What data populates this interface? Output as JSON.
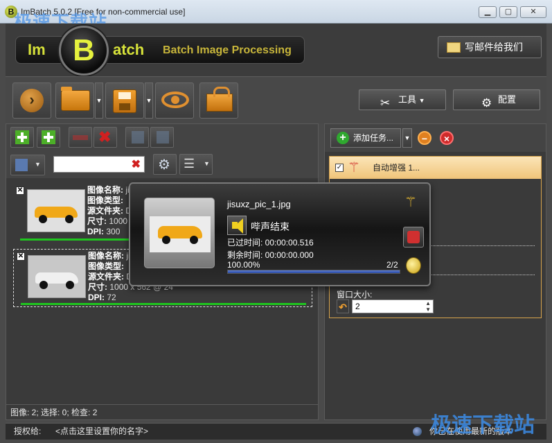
{
  "window": {
    "title": "ImBatch 5.0.2 [Free for non-commercial use]",
    "minimize_icon": "minimize-icon",
    "maximize_icon": "maximize-icon",
    "close_icon": "close-icon"
  },
  "watermark_top": "极速下载站",
  "header": {
    "logo_im": "Im",
    "logo_b": "B",
    "logo_atch": "atch",
    "tagline": "Batch Image Processing",
    "mail_button": "写邮件给我们"
  },
  "toolbar": {
    "tools_label": "工具",
    "settings_label": "配置"
  },
  "left_panel": {
    "search_value": "",
    "images": [
      {
        "checked": "✕",
        "name_label": "图像名称:",
        "name_value": "jis",
        "type_label": "图像类型:",
        "folder_label": "源文件夹:",
        "folder_value": "D:",
        "size_label": "尺寸:",
        "size_value": "1000 x",
        "dpi_label": "DPI:",
        "dpi_value": "300"
      },
      {
        "checked": "✕",
        "name_label": "图像名称:",
        "name_value": "jis",
        "type_label": "图像类型:",
        "folder_label": "源文件夹:",
        "folder_value": "D:",
        "size_label": "尺寸:",
        "size_value": "1000 x 562 @ 24",
        "dpi_label": "DPI:",
        "dpi_value": "72"
      }
    ],
    "status": "图像: 2; 选择: 0; 检查: 2"
  },
  "right_panel": {
    "add_task_label": "添加任务...",
    "task_name": "自动增强 1...",
    "task_checked": "✓",
    "window_size_label": "窗口大小:",
    "window_size_value": "2"
  },
  "popup": {
    "filename": "jisuxz_pic_1.jpg",
    "beep_label": "哔声结束",
    "elapsed": "已过时间: 00:00:00.516",
    "remaining": "剩余时间: 00:00:00.000",
    "percent_text": "100.00%",
    "count": "2/2",
    "progress": 1.0
  },
  "bottom_bar": {
    "license_label": "授权给:",
    "set_name_link": "<点击这里设置你的名字>",
    "version_status": "你已在使用最新的版本"
  },
  "watermark_bottom": "极速下载站",
  "colors": {
    "accent_yellow": "#d7e23a",
    "task_highlight": "#f0c479",
    "progress_blue": "#2a4aa0",
    "progress_green": "#1fc51f"
  }
}
